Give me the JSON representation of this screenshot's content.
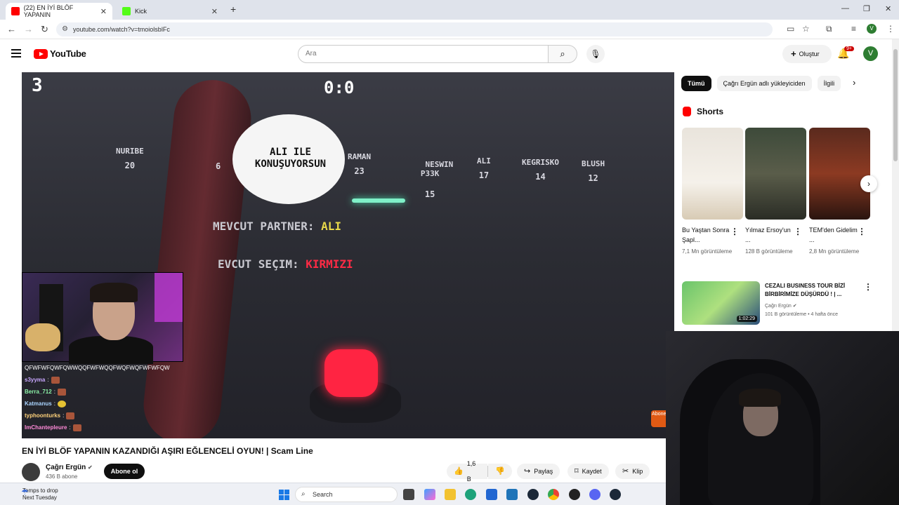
{
  "browser": {
    "tabs": [
      {
        "label": "(22) EN İYİ BLÖF YAPANIN",
        "active": true,
        "favicon_color": "#ff0000"
      },
      {
        "label": "Kick",
        "active": false,
        "favicon_color": "#53fc18"
      }
    ],
    "url": "youtube.com/watch?v=tmoiolsblFc"
  },
  "youtube": {
    "logo_text": "YouTube",
    "search_placeholder": "Ara",
    "create_label": "Oluştur",
    "notif_badge": "9+",
    "avatar_letter": "V"
  },
  "video": {
    "overlay": {
      "round": "3",
      "score": "0:0",
      "players": [
        {
          "name": "NURIBE",
          "score": "20"
        },
        {
          "name": "",
          "score": "6"
        },
        {
          "name": "RAMAN",
          "score": "23"
        },
        {
          "name": "NESWIN\nP33K",
          "score": "15"
        },
        {
          "name": "ALI",
          "score": "17"
        },
        {
          "name": "KEGRISKO",
          "score": "14"
        },
        {
          "name": "BLUSH",
          "score": "12"
        }
      ],
      "bubble_text": "ALI ILE KONUŞUYORSUN",
      "partner_label": "MEVCUT PARTNER:",
      "partner_value": "ALI",
      "choice_label": "EVCUT SEÇIM:",
      "choice_value": "KIRMIZI",
      "abone_mark": "Abone ol"
    },
    "chat": [
      {
        "user": "",
        "message": "QFWFWFQWFQWWQQFWFWQQFWQFWQFWFWFQW",
        "emote": ""
      },
      {
        "user": "s3yyma",
        "message": ":",
        "emote": "red"
      },
      {
        "user": "Berra_712",
        "message": ":",
        "emote": "red"
      },
      {
        "user": "Katmanus",
        "message": ":",
        "emote": "yellow"
      },
      {
        "user": "typhoonturks",
        "message": ":",
        "emote": "red"
      },
      {
        "user": "ImChantepleure",
        "message": ":",
        "emote": "red"
      }
    ],
    "title": "EN İYİ BLÖF YAPANIN KAZANDIĞI AŞIRI EĞLENCELİ OYUN! | Scam Line",
    "channel": {
      "name": "Çağrı Ergün",
      "subs": "436 B abone"
    },
    "subscribe_label": "Abone ol",
    "actions": {
      "likes": "1,6 B",
      "share": "Paylaş",
      "save": "Kaydet",
      "clip": "Klip"
    }
  },
  "sidebar": {
    "chips": [
      "Tümü",
      "Çağrı Ergün adlı yükleyiciden",
      "İlgili"
    ],
    "shorts_title": "Shorts",
    "shorts": [
      {
        "title": "Bu Yaştan Sonra Şapl...",
        "views": "7,1 Mn görüntüleme"
      },
      {
        "title": "Yılmaz Ersoy'un ...",
        "views": "128 B görüntüleme"
      },
      {
        "title": "TEM'den Gidelim ...",
        "views": "2,8 Mn görüntüleme"
      }
    ],
    "recommended": {
      "title": "CEZALI BUSINESS TOUR BİZİ BİRBİRİMİZE DÜŞÜRDÜ ! | ...",
      "channel": "Çağrı Ergün",
      "meta": "101 B görüntüleme • 4 hafta önce",
      "duration": "1:02:29"
    }
  },
  "taskbar": {
    "weather_line1": "Temps to drop",
    "weather_line2": "Next Tuesday",
    "search_label": "Search"
  }
}
